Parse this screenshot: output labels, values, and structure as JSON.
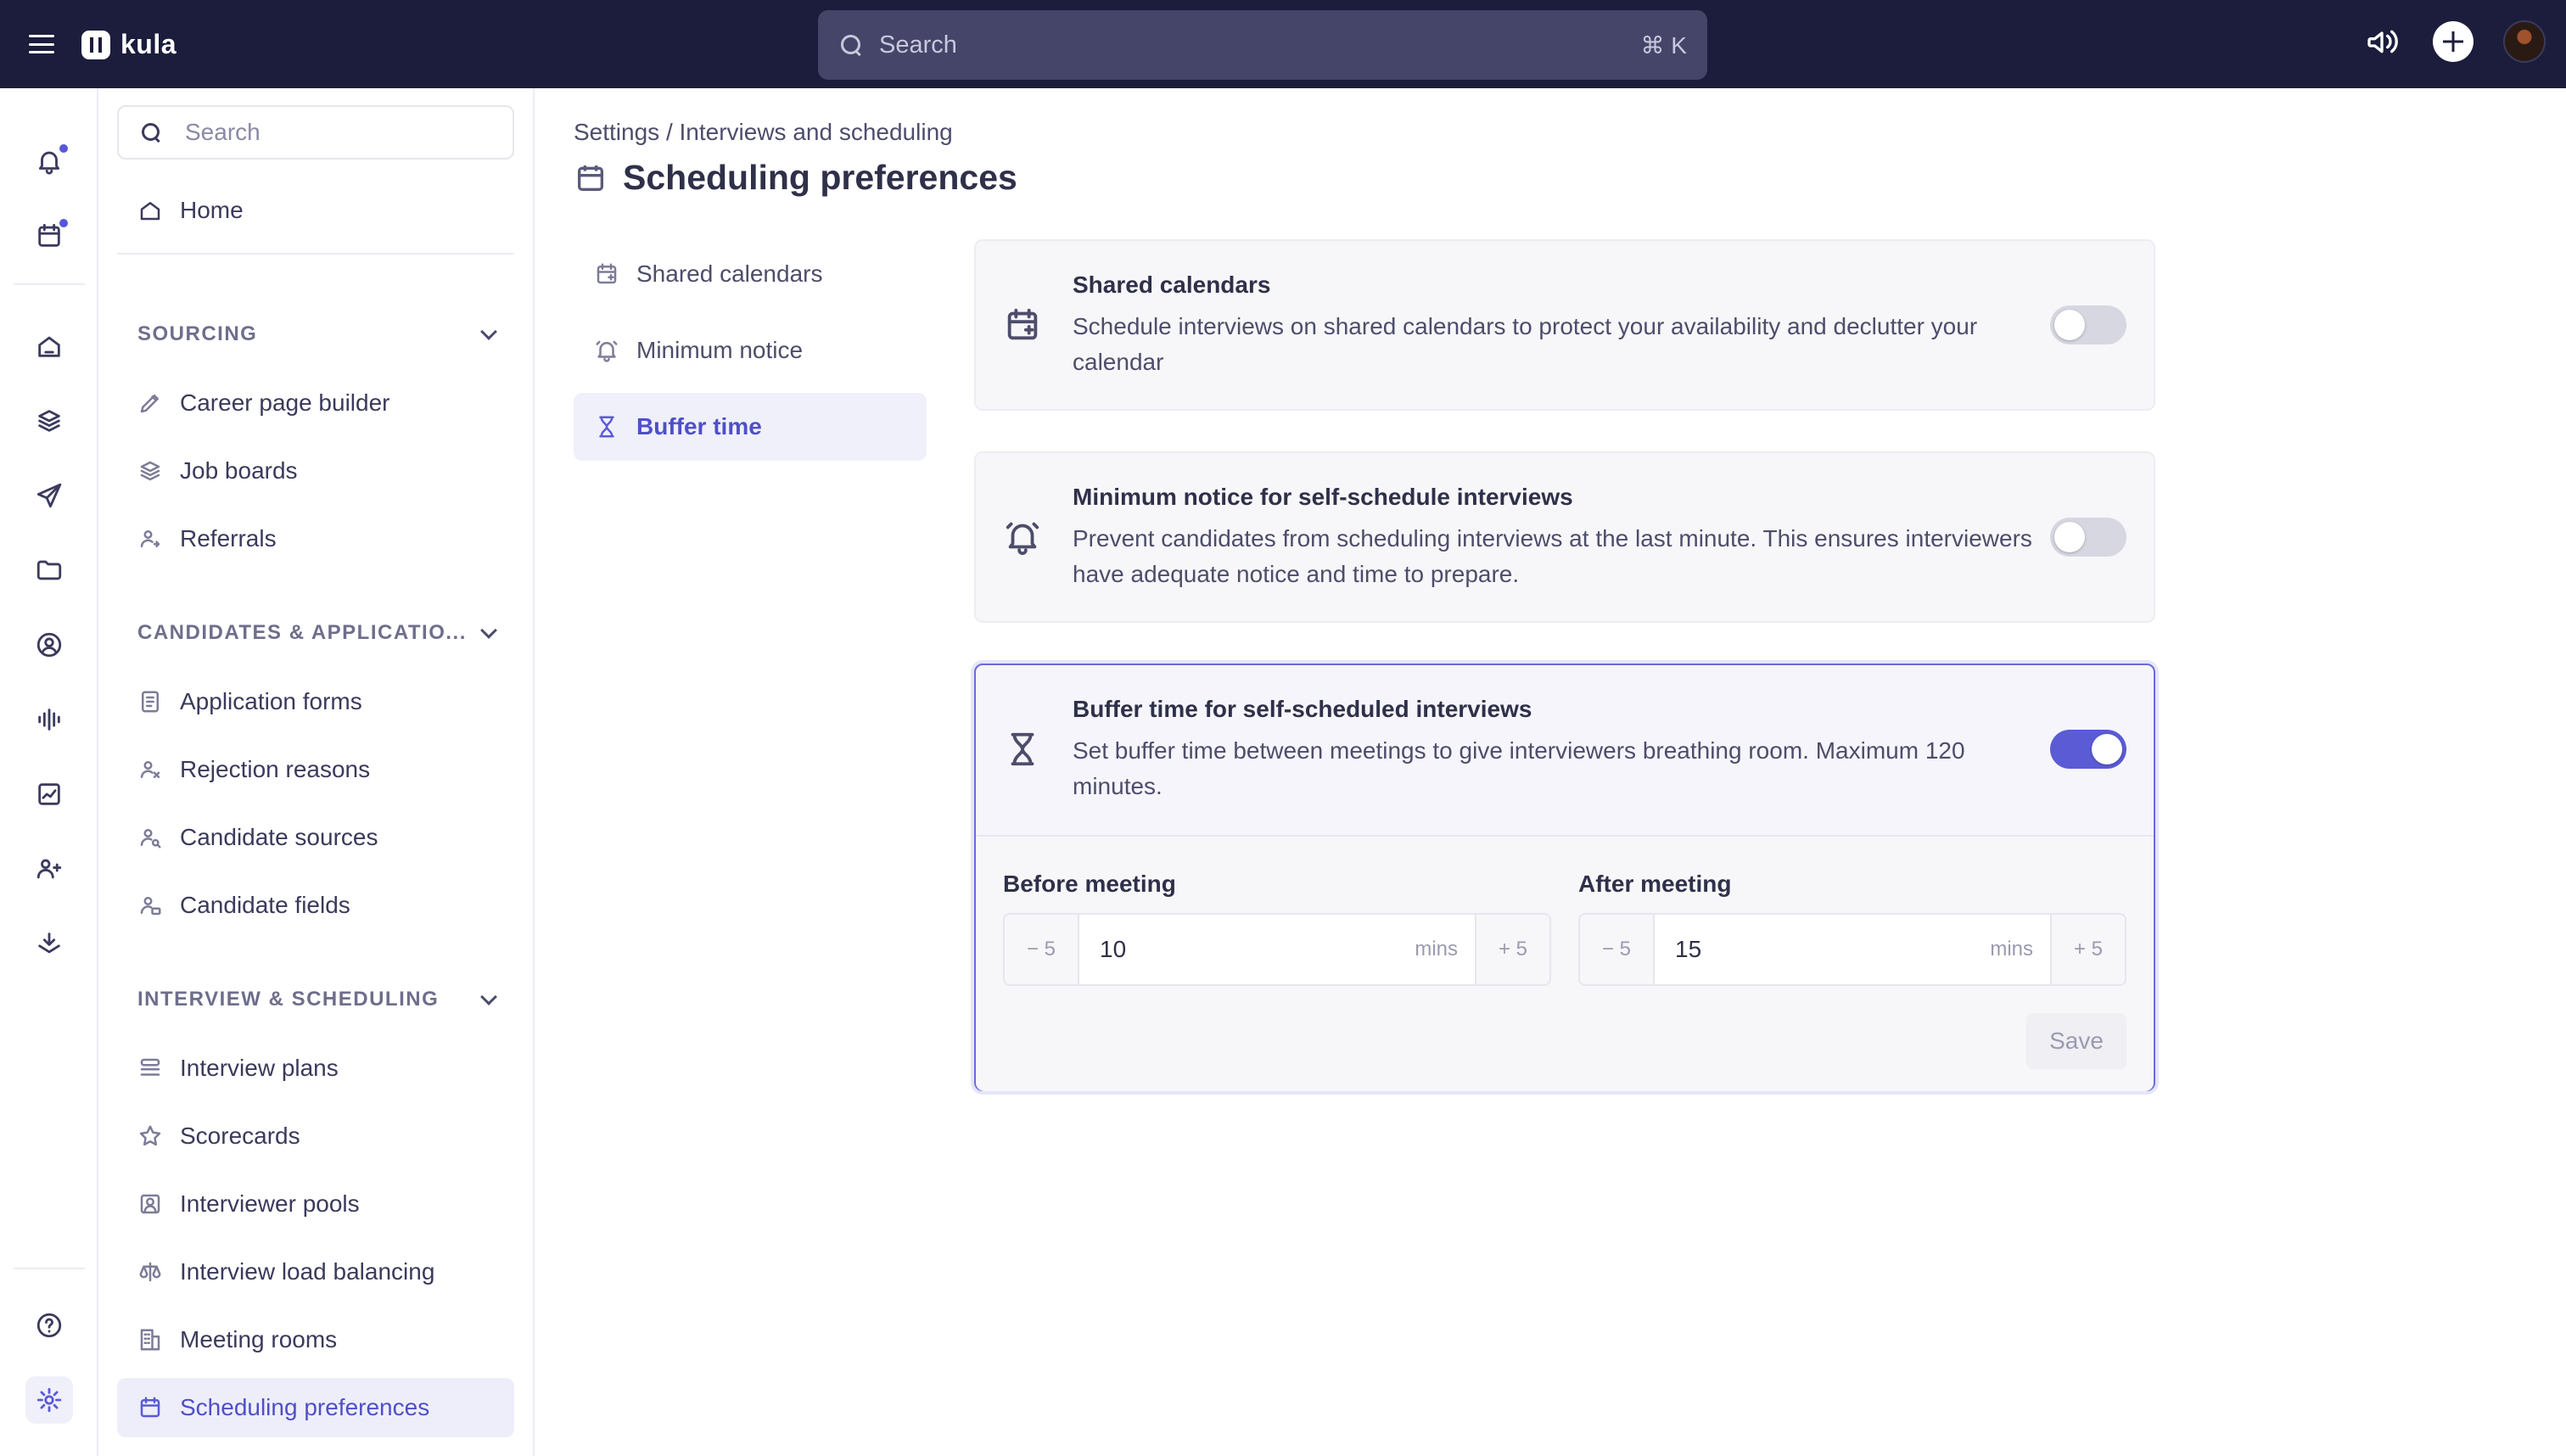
{
  "app": {
    "name": "kula"
  },
  "topbar": {
    "search_placeholder": "Search",
    "search_shortcut": "⌘ K"
  },
  "settings_nav": {
    "search_placeholder": "Search",
    "home_label": "Home",
    "sections": [
      {
        "label": "SOURCING",
        "items": [
          "Career page builder",
          "Job boards",
          "Referrals"
        ]
      },
      {
        "label": "CANDIDATES & APPLICATIO...",
        "items": [
          "Application forms",
          "Rejection reasons",
          "Candidate sources",
          "Candidate fields"
        ]
      },
      {
        "label": "INTERVIEW & SCHEDULING",
        "items": [
          "Interview plans",
          "Scorecards",
          "Interviewer pools",
          "Interview load balancing",
          "Meeting rooms",
          "Scheduling preferences"
        ]
      }
    ],
    "active_item": "Scheduling preferences"
  },
  "breadcrumb": {
    "root": "Settings",
    "separator": " / ",
    "current": "Interviews and scheduling"
  },
  "page": {
    "title": "Scheduling preferences"
  },
  "tabs": [
    {
      "label": "Shared calendars",
      "active": false
    },
    {
      "label": "Minimum notice",
      "active": false
    },
    {
      "label": "Buffer time",
      "active": true
    }
  ],
  "cards": [
    {
      "title": "Shared calendars",
      "description": "Schedule interviews on shared calendars to protect your availability and declutter your calendar",
      "enabled": false
    },
    {
      "title": "Minimum notice for self-schedule interviews",
      "description": "Prevent candidates from scheduling interviews at the last minute. This ensures interviewers have adequate notice and time to prepare.",
      "enabled": false
    },
    {
      "title": "Buffer time for self-scheduled interviews",
      "description": "Set buffer time between meetings to give interviewers breathing room. Maximum 120 minutes.",
      "enabled": true,
      "before": {
        "label": "Before meeting",
        "value": "10",
        "unit": "mins",
        "decrement": "5",
        "increment": "5"
      },
      "after": {
        "label": "After meeting",
        "value": "15",
        "unit": "mins",
        "decrement": "5",
        "increment": "5"
      },
      "save_label": "Save"
    }
  ],
  "colors": {
    "topbar": "#1c1c3c",
    "accent": "#5b5bd6",
    "notification_dot": "#5757d9"
  }
}
